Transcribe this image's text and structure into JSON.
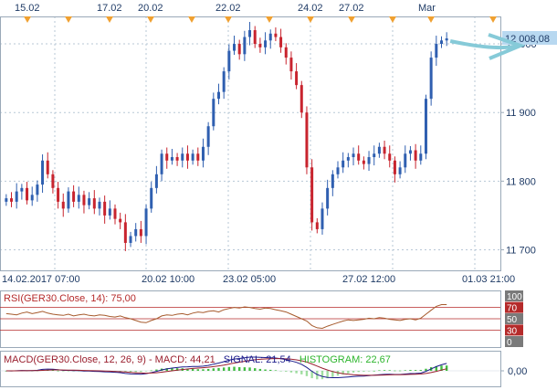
{
  "colors": {
    "background": "#ffffff",
    "plot_border": "#9aa9b8",
    "grid": "#b7c7d6",
    "up": "#2f5fb0",
    "down": "#c8242e",
    "axis_label": "#1f3b66",
    "marker": "#f0a030",
    "price_box": "#b8d8f0",
    "arrow": "#86cad8",
    "rsi_line": "#a65a2c",
    "rsi_level": "#b52a2a",
    "rsi_box_top": "#7a7a7a",
    "rsi_box_mid": "#b52a2a",
    "macd_line": "#1b1b8a",
    "signal_line": "#9a1f2e",
    "hist_up": "#2db52d",
    "title_macd": "#9a1f2e",
    "title_signal": "#1b1b8a",
    "title_hist": "#2db52d"
  },
  "top_dates": [
    "15.02",
    "17.02",
    "20.02",
    "22.02",
    "24.02",
    "27.02",
    "Mar"
  ],
  "bottom_dates": [
    "14.02.2017 07:00",
    "20.02 10:00",
    "23.02 05:00",
    "27.02 12:00",
    "01.03 21:00"
  ],
  "price_ticks": [
    "11 700",
    "11 800",
    "11 900",
    "12 000"
  ],
  "last_price": "12 008,08",
  "rsi": {
    "title": "RSI(GER30.Close, 14): 75,00",
    "levels": [
      "100",
      "70",
      "50",
      "30",
      "0"
    ],
    "values": [
      59,
      58,
      57,
      60,
      62,
      59,
      61,
      63,
      60,
      58,
      57,
      56,
      58,
      55,
      57,
      58,
      56,
      55,
      57,
      56,
      54,
      53,
      55,
      52,
      50,
      47,
      44,
      43,
      47,
      50,
      55,
      57,
      56,
      58,
      59,
      57,
      60,
      62,
      61,
      63,
      64,
      62,
      66,
      68,
      70,
      69,
      71,
      70,
      68,
      67,
      69,
      68,
      66,
      64,
      62,
      58,
      54,
      50,
      46,
      38,
      34,
      33,
      37,
      40,
      43,
      46,
      48,
      47,
      48,
      49,
      51,
      50,
      52,
      51,
      49,
      48,
      47,
      49,
      50,
      48,
      51,
      58,
      65,
      72,
      75,
      75
    ]
  },
  "macd": {
    "title_prefix": "MACD(GER30.Close, 12, 26, 9)  -  ",
    "title_macd": "MACD: 44,21",
    "title_signal": "SIGNAL: 21,54",
    "title_hist": "HISTOGRAM: 22,67",
    "zero_label": "0,00"
  },
  "chart_data": {
    "type": "candlestick",
    "ylim": [
      11670,
      12040
    ],
    "y_ticks": [
      11700,
      11800,
      11900,
      12000
    ],
    "x_top_labels": [
      "15.02",
      "17.02",
      "20.02",
      "22.02",
      "24.02",
      "27.02",
      "Mar"
    ],
    "x_bottom_labels": [
      "14.02.2017 07:00",
      "20.02 10:00",
      "23.02 05:00",
      "27.02 12:00",
      "01.03 21:00"
    ],
    "last_price": 12008.08,
    "closes": [
      11775,
      11770,
      11785,
      11790,
      11772,
      11780,
      11795,
      11830,
      11810,
      11790,
      11770,
      11760,
      11785,
      11770,
      11780,
      11765,
      11775,
      11760,
      11770,
      11750,
      11760,
      11745,
      11740,
      11710,
      11720,
      11730,
      11720,
      11760,
      11790,
      11810,
      11840,
      11830,
      11835,
      11830,
      11840,
      11830,
      11840,
      11830,
      11850,
      11880,
      11920,
      11930,
      11960,
      11990,
      12000,
      11985,
      12010,
      12020,
      12000,
      11995,
      12005,
      12015,
      12010,
      11995,
      11980,
      11960,
      11940,
      11900,
      11820,
      11740,
      11730,
      11760,
      11790,
      11810,
      11820,
      11830,
      11835,
      11840,
      11830,
      11825,
      11835,
      11840,
      11850,
      11840,
      11830,
      11810,
      11820,
      11840,
      11845,
      11830,
      11840,
      11920,
      11980,
      12000,
      12005,
      12008
    ]
  }
}
